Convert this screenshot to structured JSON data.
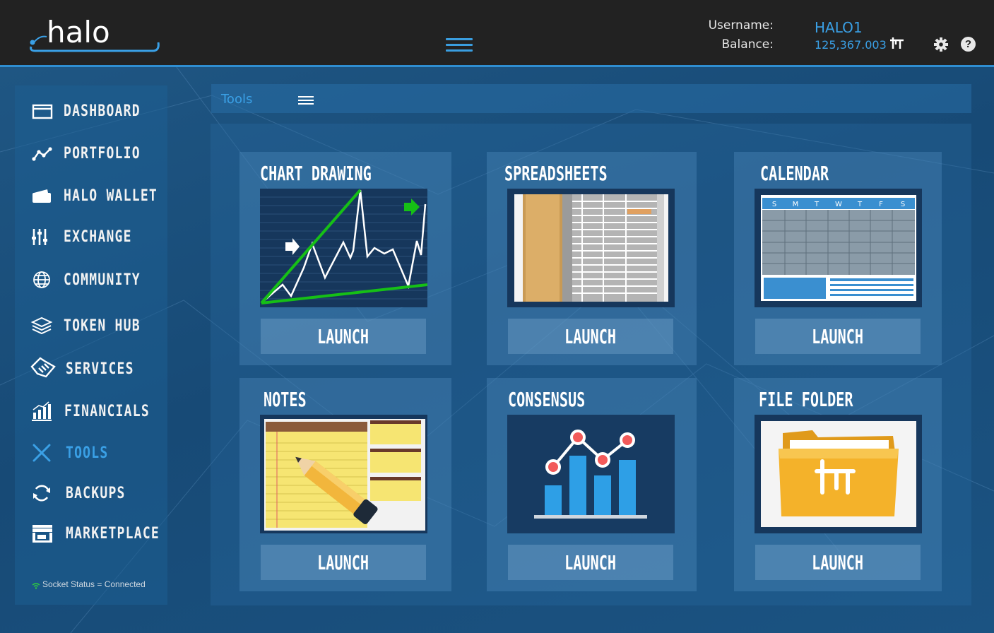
{
  "header": {
    "logo_text": "halo",
    "username_label": "Username:",
    "username_value": "HALO1",
    "balance_label": "Balance:",
    "balance_value": "125,367.003",
    "icons": [
      "hamburger-menu-icon",
      "halo-coin-icon",
      "gear-icon",
      "help-icon"
    ],
    "help_glyph": "?"
  },
  "sidebar": {
    "items": [
      {
        "label": "DASHBOARD",
        "icon": "browser-window-icon"
      },
      {
        "label": "PORTFOLIO",
        "icon": "line-graph-icon"
      },
      {
        "label": "HALO WALLET",
        "icon": "wallet-icon"
      },
      {
        "label": "EXCHANGE",
        "icon": "sliders-icon"
      },
      {
        "label": "COMMUNITY",
        "icon": "globe-icon"
      },
      {
        "label": "TOKEN HUB",
        "icon": "layers-icon"
      },
      {
        "label": "SERVICES",
        "icon": "handshake-icon"
      },
      {
        "label": "FINANCIALS",
        "icon": "bar-chart-icon"
      },
      {
        "label": "TOOLS",
        "icon": "tools-icon",
        "active": true
      },
      {
        "label": "BACKUPS",
        "icon": "refresh-icon"
      },
      {
        "label": "MARKETPLACE",
        "icon": "storefront-icon"
      }
    ],
    "socket_status": "Socket Status = Connected"
  },
  "breadcrumb": {
    "label": "Tools"
  },
  "tools": [
    {
      "title": "CHART DRAWING",
      "launch": "LAUNCH",
      "thumb": "chart-drawing-thumbnail"
    },
    {
      "title": "SPREADSHEETS",
      "launch": "LAUNCH",
      "thumb": "spreadsheet-thumbnail"
    },
    {
      "title": "CALENDAR",
      "launch": "LAUNCH",
      "thumb": "calendar-thumbnail",
      "weekdays": [
        "S",
        "M",
        "T",
        "W",
        "T",
        "F",
        "S"
      ]
    },
    {
      "title": "NOTES",
      "launch": "LAUNCH",
      "thumb": "notes-thumbnail"
    },
    {
      "title": "CONSENSUS",
      "launch": "LAUNCH",
      "thumb": "consensus-chart-thumbnail"
    },
    {
      "title": "FILE FOLDER",
      "launch": "LAUNCH",
      "thumb": "file-folder-thumbnail"
    }
  ],
  "colors": {
    "accent": "#3aa0e6",
    "topbar": "#222222",
    "background": "#1a4a72"
  }
}
